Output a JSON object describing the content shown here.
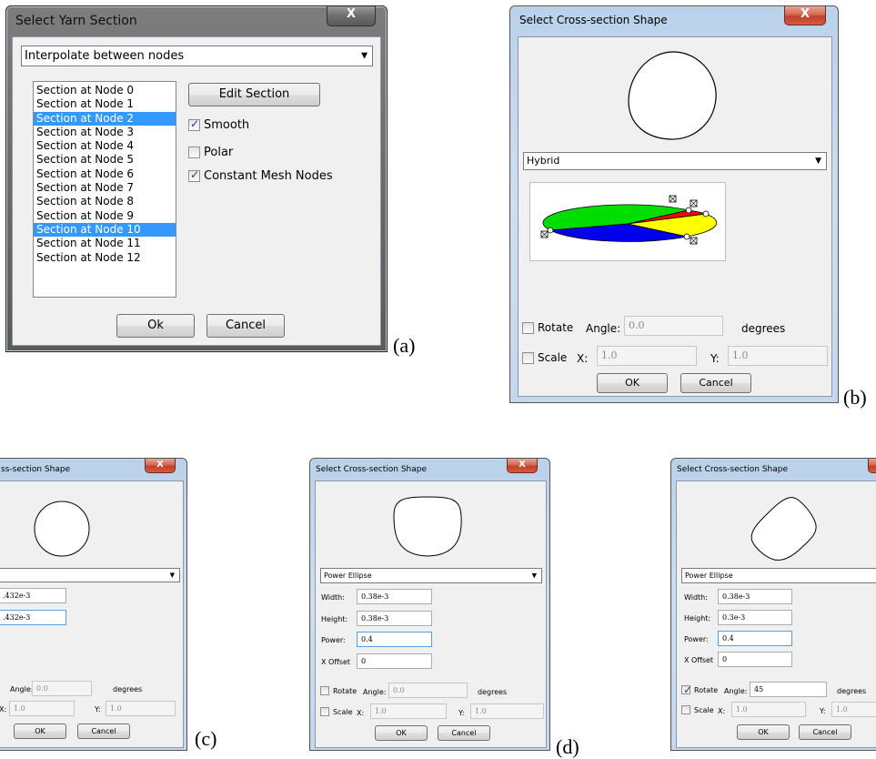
{
  "dialog_a": {
    "title": "Select Yarn Section",
    "close_glyph": "X",
    "combo_value": "Interpolate between nodes",
    "sections": [
      {
        "label": "Section at Node 0",
        "selected": false
      },
      {
        "label": "Section at Node 1",
        "selected": false
      },
      {
        "label": "Section at Node 2",
        "selected": true
      },
      {
        "label": "Section at Node 3",
        "selected": false
      },
      {
        "label": "Section at Node 4",
        "selected": false
      },
      {
        "label": "Section at Node 5",
        "selected": false
      },
      {
        "label": "Section at Node 6",
        "selected": false
      },
      {
        "label": "Section at Node 7",
        "selected": false
      },
      {
        "label": "Section at Node 8",
        "selected": false
      },
      {
        "label": "Section at Node 9",
        "selected": false
      },
      {
        "label": "Section at Node 10",
        "selected": true
      },
      {
        "label": "Section at Node 11",
        "selected": false
      },
      {
        "label": "Section at Node 12",
        "selected": false
      }
    ],
    "edit_button": "Edit Section",
    "smooth_label": "Smooth",
    "smooth_checked": true,
    "polar_label": "Polar",
    "polar_checked": false,
    "constant_label": "Constant Mesh Nodes",
    "constant_checked": true,
    "ok_button": "Ok",
    "cancel_button": "Cancel",
    "caption": "(a)"
  },
  "dialog_b": {
    "title": "Select Cross-section Shape",
    "close_glyph": "X",
    "shape_type": "Hybrid",
    "hybrid_colors": [
      "#00dd00",
      "#ff0000",
      "#ffff00",
      "#0000ee"
    ],
    "rotate_label": "Rotate",
    "rotate_checked": false,
    "angle_label": "Angle:",
    "angle_value": "0.0",
    "degrees_label": "degrees",
    "scale_label": "Scale",
    "scale_checked": false,
    "x_label": "X:",
    "x_value": "1.0",
    "y_label": "Y:",
    "y_value": "1.0",
    "ok_button": "OK",
    "cancel_button": "Cancel",
    "caption": "(b)"
  },
  "dialog_c": {
    "title": "ss-section Shape",
    "close_glyph": "X",
    "width_value": ".432e-3",
    "height_value": ".432e-3",
    "angle_label": "Angle:",
    "angle_value": "0.0",
    "degrees_label": "degrees",
    "x_label": "X:",
    "x_value": "1.0",
    "y_label": "Y:",
    "y_value": "1.0",
    "ok_button": "OK",
    "cancel_button": "Cancel",
    "caption": "(c)"
  },
  "dialog_d": {
    "title": "Select Cross-section Shape",
    "close_glyph": "X",
    "shape_type": "Power Ellipse",
    "width_label": "Width:",
    "width_value": "0.38e-3",
    "height_label": "Height:",
    "height_value": "0.38e-3",
    "power_label": "Power:",
    "power_value": "0.4",
    "xoffset_label": "X Offset",
    "xoffset_value": "0",
    "rotate_label": "Rotate",
    "rotate_checked": false,
    "angle_label": "Angle:",
    "angle_value": "0.0",
    "degrees_label": "degrees",
    "scale_label": "Scale",
    "scale_checked": false,
    "x_label": "X:",
    "x_value": "1.0",
    "y_label": "Y:",
    "y_value": "1.0",
    "ok_button": "OK",
    "cancel_button": "Cancel",
    "caption": "(d)"
  },
  "dialog_e": {
    "title": "Select Cross-section Shape",
    "shape_type": "Power Ellipse",
    "width_label": "Width:",
    "width_value": "0.38e-3",
    "height_label": "Height:",
    "height_value": "0.3e-3",
    "power_label": "Power:",
    "power_value": "0.4",
    "xoffset_label": "X Offset",
    "xoffset_value": "0",
    "rotate_label": "Rotate",
    "rotate_checked": true,
    "angle_label": "Angle:",
    "angle_value": "45",
    "degrees_label": "degrees",
    "scale_label": "Scale",
    "scale_checked": false,
    "x_label": "X:",
    "x_value": "1.0",
    "y_label": "Y:",
    "y_value": "1.0",
    "ok_button": "OK",
    "cancel_button": "Cancel"
  }
}
